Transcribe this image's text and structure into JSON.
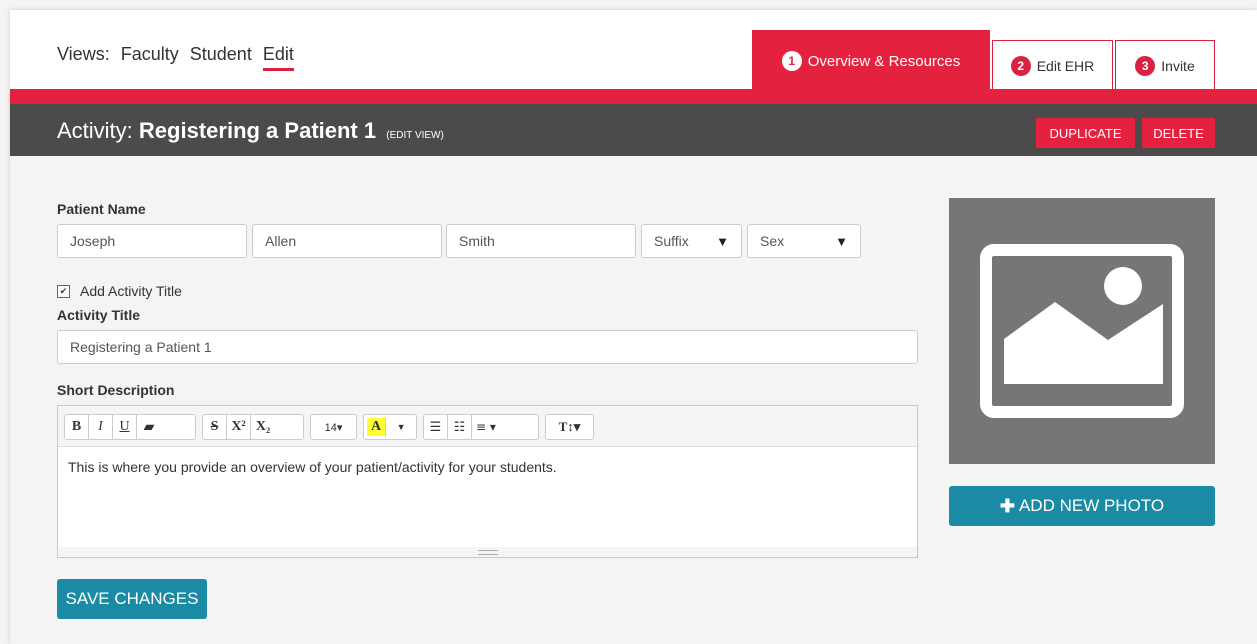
{
  "views": {
    "label": "Views:",
    "items": [
      "Faculty",
      "Student",
      "Edit"
    ]
  },
  "tabs": [
    {
      "num": "1",
      "label": "Overview & Resources"
    },
    {
      "num": "2",
      "label": "Edit EHR"
    },
    {
      "num": "3",
      "label": "Invite"
    }
  ],
  "activity": {
    "prefix": "Activity:",
    "name": "Registering a Patient 1",
    "suffix": "(EDIT VIEW)",
    "duplicate_label": "DUPLICATE",
    "delete_label": "DELETE"
  },
  "patient": {
    "label": "Patient Name",
    "first": "Joseph",
    "middle": "Allen",
    "last": "Smith",
    "suffix": "Suffix",
    "sex": "Sex"
  },
  "add_title": {
    "checked": true,
    "label": "Add Activity Title"
  },
  "activity_title": {
    "label": "Activity Title",
    "value": "Registering a Patient 1"
  },
  "description": {
    "label": "Short Description",
    "text": "This is where you provide an overview of your patient/activity for your students.",
    "font_size": "14▾"
  },
  "save_label": "SAVE CHANGES",
  "add_photo_label": "ADD NEW PHOTO",
  "colors": {
    "accent_red": "#e4213f",
    "teal": "#1b8aa5",
    "dark_bar": "#4b4b4b"
  }
}
